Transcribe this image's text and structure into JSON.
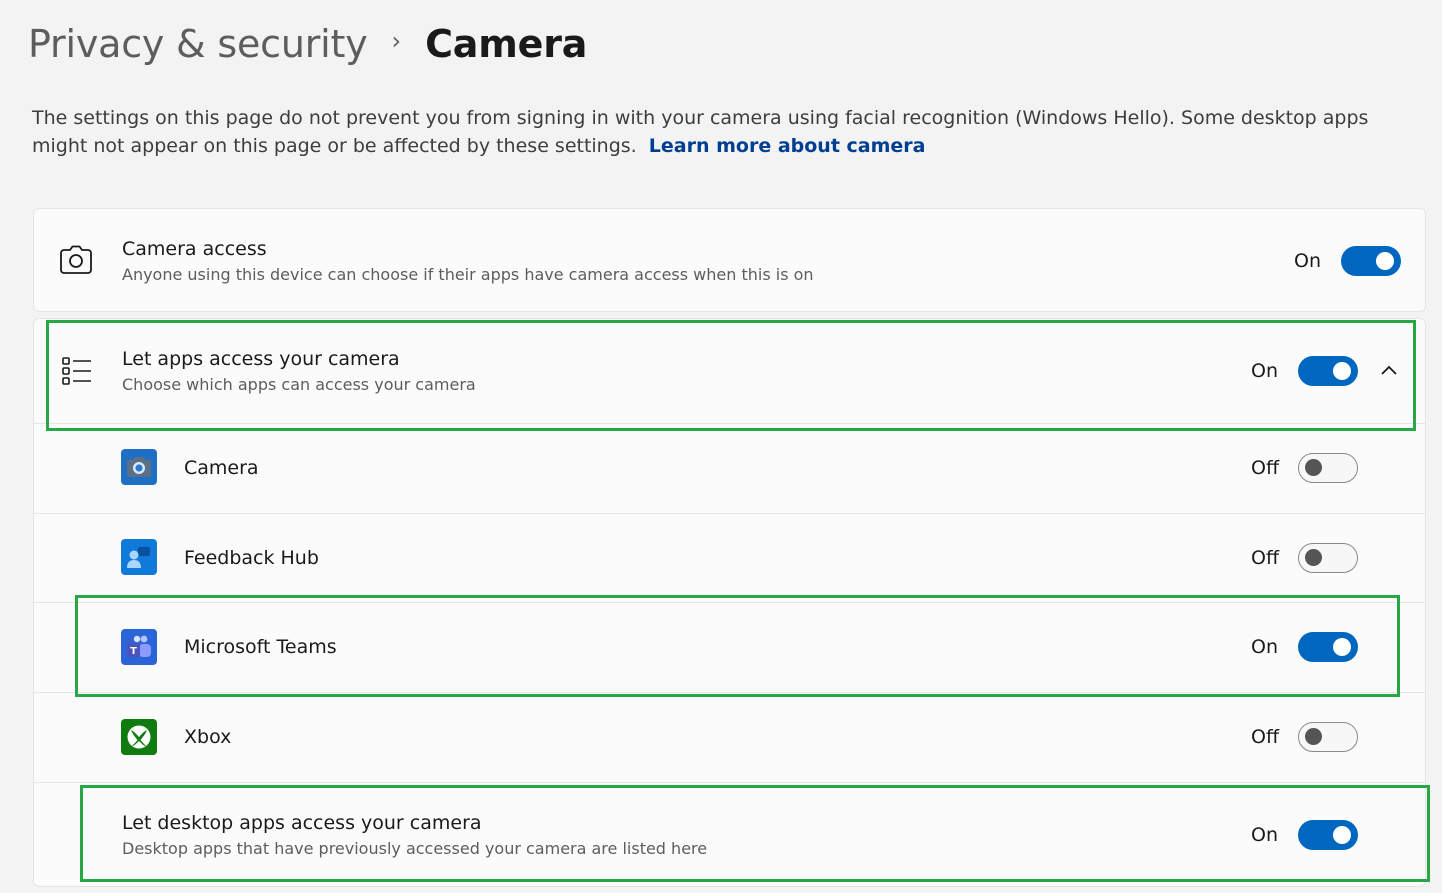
{
  "breadcrumb": {
    "parent": "Privacy & security",
    "separator": "›",
    "current": "Camera"
  },
  "description": {
    "text": "The settings on this page do not prevent you from signing in with your camera using facial recognition (Windows Hello). Some desktop apps might not appear on this page or be affected by these settings.",
    "link": "Learn more about camera"
  },
  "camera_access": {
    "icon": "camera-icon",
    "title": "Camera access",
    "subtitle": "Anyone using this device can choose if their apps have camera access when this is on",
    "state": "On"
  },
  "let_apps": {
    "icon": "list-icon",
    "title": "Let apps access your camera",
    "subtitle": "Choose which apps can access your camera",
    "state": "On",
    "chevron": "chevron-up-icon"
  },
  "apps": [
    {
      "name": "Camera",
      "state": "Off",
      "icon": "camera-app-icon"
    },
    {
      "name": "Feedback Hub",
      "state": "Off",
      "icon": "feedback-hub-icon"
    },
    {
      "name": "Microsoft Teams",
      "state": "On",
      "icon": "teams-icon"
    },
    {
      "name": "Xbox",
      "state": "Off",
      "icon": "xbox-icon"
    }
  ],
  "desktop_apps": {
    "title": "Let desktop apps access your camera",
    "subtitle": "Desktop apps that have previously accessed your camera are listed here",
    "state": "On"
  },
  "colors": {
    "accent": "#0067c0",
    "link": "#003e92",
    "highlight": "#27a745"
  }
}
